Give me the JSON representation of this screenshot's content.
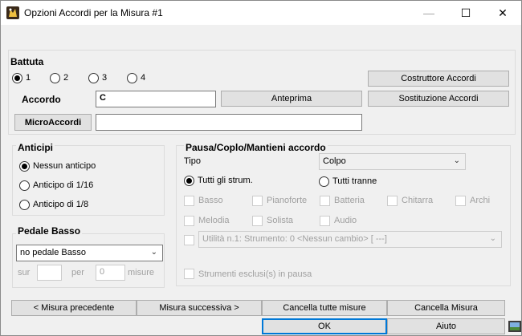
{
  "window": {
    "title": "Opzioni Accordi per la Misura #1",
    "minimize": "—",
    "maximize": "☐",
    "close": "✕"
  },
  "battuta": {
    "title": "Battuta",
    "options": [
      "1",
      "2",
      "3",
      "4"
    ],
    "selected": "1"
  },
  "accordo": {
    "label": "Accordo",
    "value": "C"
  },
  "buttons": {
    "costruttore": "Costruttore Accordi",
    "anteprima": "Anteprima",
    "sostituzione": "Sostituzione Accordi",
    "microaccordi": "MicroAccordi",
    "prev": "< Misura precedente",
    "next": "Misura successiva >",
    "cancella_tutte": "Cancella tutte misure",
    "cancella": "Cancella Misura",
    "ok": "OK",
    "aiuto": "Aiuto"
  },
  "microaccordi": {
    "value": ""
  },
  "anticipi": {
    "title": "Anticipi",
    "options": [
      "Nessun anticipo",
      "Anticipo di 1/16",
      "Anticipo di 1/8"
    ],
    "selected": "Nessun anticipo"
  },
  "pedale": {
    "title": "Pedale Basso",
    "selected": "no pedale Basso",
    "sur_label": "sur",
    "sur_value": "",
    "per_label": "per",
    "per_value": "0",
    "misure_label": "misure"
  },
  "pausa": {
    "title": "Pausa/Coplo/Mantieni accordo",
    "tipo_label": "Tipo",
    "tipo_value": "Colpo",
    "tutti_gli": "Tutti gli strum.",
    "tutti_tranne": "Tutti tranne",
    "instruments_row1": [
      "Basso",
      "Pianoforte",
      "Batteria",
      "Chitarra",
      "Archi"
    ],
    "instruments_row2": [
      "Melodia",
      "Solista",
      "Audio"
    ],
    "utility_value": "Utilità n.1: Strumento: 0 <Nessun cambio> [ ---]",
    "esclusi": "Strumenti esclusi(s) in pausa"
  }
}
